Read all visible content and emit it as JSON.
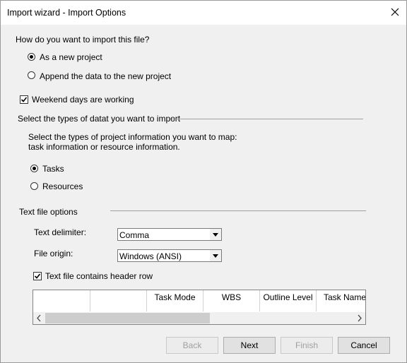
{
  "window": {
    "title": "Import wizard - Import Options"
  },
  "import_how": {
    "question": "How do you want to import this file?",
    "options": [
      "As a new project",
      "Append the data to the new project"
    ],
    "selected_index": 0
  },
  "weekend": {
    "label": "Weekend days are working",
    "checked": true
  },
  "types": {
    "section_title": "Select the types of datat you want to import",
    "description_line1": "Select the types of project information you want to map:",
    "description_line2": "task information or resource information.",
    "options": [
      "Tasks",
      "Resources"
    ],
    "selected_index": 0
  },
  "text_file": {
    "section_title": "Text file options",
    "delimiter_label": "Text delimiter:",
    "delimiter_value": "Comma",
    "origin_label": "File origin:",
    "origin_value": "Windows (ANSI)",
    "header_row_label": "Text file contains header row",
    "header_row_checked": true
  },
  "preview_grid": {
    "columns": [
      "",
      "",
      "Task Mode",
      "WBS",
      "Outline Level",
      "Task Name"
    ]
  },
  "buttons": {
    "back": "Back",
    "next": "Next",
    "finish": "Finish",
    "cancel": "Cancel"
  },
  "icons": {
    "close": "close-icon",
    "dropdown": "chevron-down-icon",
    "scroll_left": "scroll-left-arrow-icon",
    "scroll_right": "scroll-right-arrow-icon",
    "checkmark": "checkmark-icon"
  }
}
